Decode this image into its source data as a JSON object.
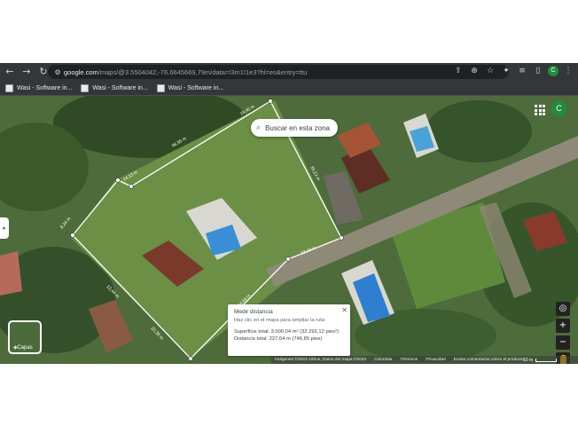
{
  "browser": {
    "url_host": "google.com",
    "url_path": "/maps/@3.5504042,-76.6645669,79m/data=!3m1!1e3?hl=es&entry=ttu",
    "profile_initial": "C",
    "bookmarks": [
      {
        "label": "Wasi - Software in..."
      },
      {
        "label": "Wasi - Software in..."
      },
      {
        "label": "Wasi - Software in..."
      }
    ]
  },
  "map": {
    "search_zone_label": "Buscar en esta zona",
    "account_initial": "C",
    "layers_label": "Capas",
    "segment_labels": [
      "46,55 m",
      "19,40 m",
      "14,13 m",
      "39,22 m",
      "33,19 m",
      "24,54 m",
      "8,34 m",
      "12,44 m",
      "20,38 m"
    ],
    "measure": {
      "title": "Medir distancia",
      "hint": "Haz clic en el mapa para ampliar la ruta",
      "area": "Superficie total: 3.000,04 m² (32.292,12 pies²)",
      "distance": "Distancia total: 227,64 m (746,85 pies)"
    },
    "footer": [
      "Imágenes ©2023 Airbus, Datos del mapa ©2023",
      "Colombia",
      "Términos",
      "Privacidad",
      "Enviar comentarios sobre el producto"
    ],
    "scale_label": "10 m",
    "colors": {
      "accent": "#1a73e8",
      "browser_bar": "#35363a",
      "measure_line": "#ffffff"
    }
  }
}
